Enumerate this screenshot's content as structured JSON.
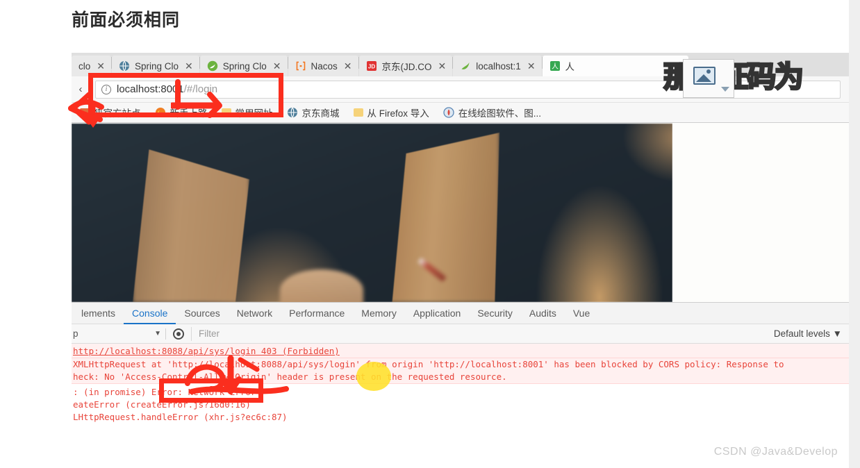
{
  "page": {
    "title": "前面必须相同",
    "watermark": "CSDN @Java&Develop",
    "overlay_text": "那验证码为"
  },
  "browser": {
    "tabs": [
      {
        "label": "clo",
        "icon": "globe-icon",
        "active": false
      },
      {
        "label": "Spring Clo",
        "icon": "globe-icon",
        "active": false
      },
      {
        "label": "Spring Clo",
        "icon": "spring-leaf-icon",
        "active": false
      },
      {
        "label": "Nacos",
        "icon": "nacos-icon",
        "active": false
      },
      {
        "label": "京东(JD.CO",
        "icon": "jd-icon",
        "active": false
      },
      {
        "label": "localhost:1",
        "icon": "spring-leaf-icon",
        "active": false
      },
      {
        "label": "人",
        "icon": "person-icon",
        "active": true
      }
    ],
    "tab_close_label": "✕",
    "toolbar": {
      "back_label": "‹",
      "url_prefix": "localhost:8001",
      "url_suffix": "/#/login",
      "security_icon": "info-icon"
    },
    "bookmarks": [
      {
        "label": "狐官方站点",
        "icon": "bookmark-icon"
      },
      {
        "label": "新手上路",
        "icon": "firefox-icon"
      },
      {
        "label": "常用网址",
        "icon": "folder-icon"
      },
      {
        "label": "京东商城",
        "icon": "globe-icon"
      },
      {
        "label": "从 Firefox 导入",
        "icon": "folder-icon"
      },
      {
        "label": "在线绘图软件、图...",
        "icon": "drawio-icon"
      }
    ]
  },
  "devtools": {
    "tabs": [
      {
        "label": "lements",
        "active": false
      },
      {
        "label": "Console",
        "active": true
      },
      {
        "label": "Sources",
        "active": false
      },
      {
        "label": "Network",
        "active": false
      },
      {
        "label": "Performance",
        "active": false
      },
      {
        "label": "Memory",
        "active": false
      },
      {
        "label": "Application",
        "active": false
      },
      {
        "label": "Security",
        "active": false
      },
      {
        "label": "Audits",
        "active": false
      },
      {
        "label": "Vue",
        "active": false
      }
    ],
    "toolbar": {
      "context_value": "p",
      "context_caret": "▼",
      "eye_icon": "eye-icon",
      "filter_placeholder": "Filter",
      "levels_label": "Default levels ▼"
    },
    "console_lines": [
      "http://localhost:8088/api/sys/login 403 (Forbidden)",
      "XMLHttpRequest at 'http://localhost:8088/api/sys/login' from origin 'http://localhost:8001' has been blocked by CORS policy: Response to",
      "heck: No 'Access-Control-Allow-Origin' header is present on the requested resource.",
      ": (in promise) Error: Network Error",
      "eateError (createError.js?16d0:16)",
      "LHttpRequest.handleError (xhr.js?ec6c:87)"
    ]
  },
  "colors": {
    "annotation_red": "#fb2e1e",
    "highlight_yellow": "#ffe02a",
    "teal_button": "#14a0a8",
    "devtools_accent": "#1a73c8"
  }
}
